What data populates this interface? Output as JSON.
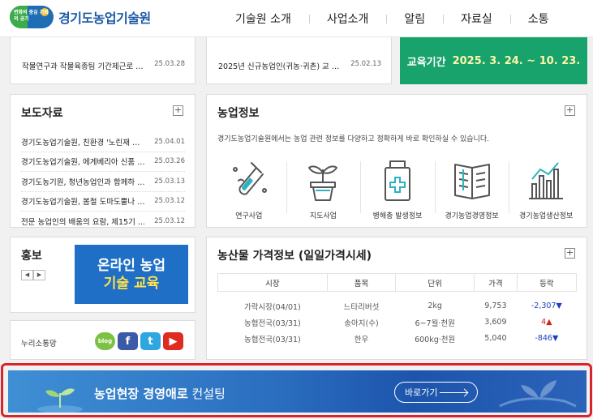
{
  "header": {
    "logo_small": "변화의 중심 기회의 공기",
    "logo_text": "경기도농업기술원",
    "nav": [
      "기술원 소개",
      "사업소개",
      "알림",
      "자료실",
      "소통"
    ]
  },
  "top_strip": {
    "left": {
      "title": "작물연구과 작물육종팀 기간제근로 …",
      "date": "25.03.28"
    },
    "mid": {
      "title": "2025년 신규농업인(귀농·귀촌) 교 …",
      "date": "25.02.13"
    },
    "banner_label": "교육기간",
    "banner_period": "2025. 3. 24. ~ 10. 23."
  },
  "news": {
    "title": "보도자료",
    "plus": "+",
    "items": [
      {
        "title": "경기도농업기술원, 친환경 '노린재 …",
        "date": "25.04.01"
      },
      {
        "title": "경기도농업기술원, 에게베리아 신품 …",
        "date": "25.03.26"
      },
      {
        "title": "경기도농기원, 청년농업인과 함께하 …",
        "date": "25.03.13"
      },
      {
        "title": "경기도농업기술원, 봄철 도마도뿔나 …",
        "date": "25.03.12"
      },
      {
        "title": "전문 농업인의 배움의 요람, 제15기 …",
        "date": "25.03.12"
      }
    ]
  },
  "info": {
    "title": "농업정보",
    "plus": "+",
    "desc": "경기도농업기술원에서는 농업 관련 정보를 다양하고 정확하게 바로 확인하실 수 있습니다.",
    "items": [
      {
        "label": "연구사업",
        "icon": "test-tube-icon"
      },
      {
        "label": "지도사업",
        "icon": "sprout-pot-icon"
      },
      {
        "label": "병해충 발생정보",
        "icon": "medicine-bottle-icon"
      },
      {
        "label": "경기농업경영정보",
        "icon": "open-book-icon"
      },
      {
        "label": "경기농업생산정보",
        "icon": "bar-chart-icon"
      }
    ]
  },
  "promo": {
    "title": "홍보",
    "prev": "◀",
    "next": "▶",
    "banner_line1": "온라인 농업",
    "banner_line2": "기술 교육"
  },
  "sns": {
    "label": "누리소통망",
    "icons": [
      {
        "name": "blog-icon",
        "glyph": "blog"
      },
      {
        "name": "facebook-icon",
        "glyph": "f"
      },
      {
        "name": "twitter-icon",
        "glyph": "t"
      },
      {
        "name": "youtube-icon",
        "glyph": "▶"
      }
    ]
  },
  "price": {
    "title": "농산물 가격정보 (일일가격시세)",
    "plus": "+",
    "headers": [
      "시장",
      "품목",
      "단위",
      "가격",
      "등락"
    ],
    "rows": [
      {
        "market": "가락시장(04/01)",
        "item": "느타리버섯",
        "unit": "2kg",
        "price": "9,753",
        "change": "-2,307",
        "dir": "▼"
      },
      {
        "market": "농협전국(03/31)",
        "item": "송아지(수)",
        "unit": "6~7월·천원",
        "price": "3,609",
        "change": "4",
        "dir": "▲"
      },
      {
        "market": "농협전국(03/31)",
        "item": "한우",
        "unit": "600kg·천원",
        "price": "5,040",
        "change": "-846",
        "dir": "▼"
      }
    ]
  },
  "consult": {
    "text_bold": "농업현장 경영애로",
    "text_rest": " 컨설팅",
    "button": "바로가기"
  }
}
